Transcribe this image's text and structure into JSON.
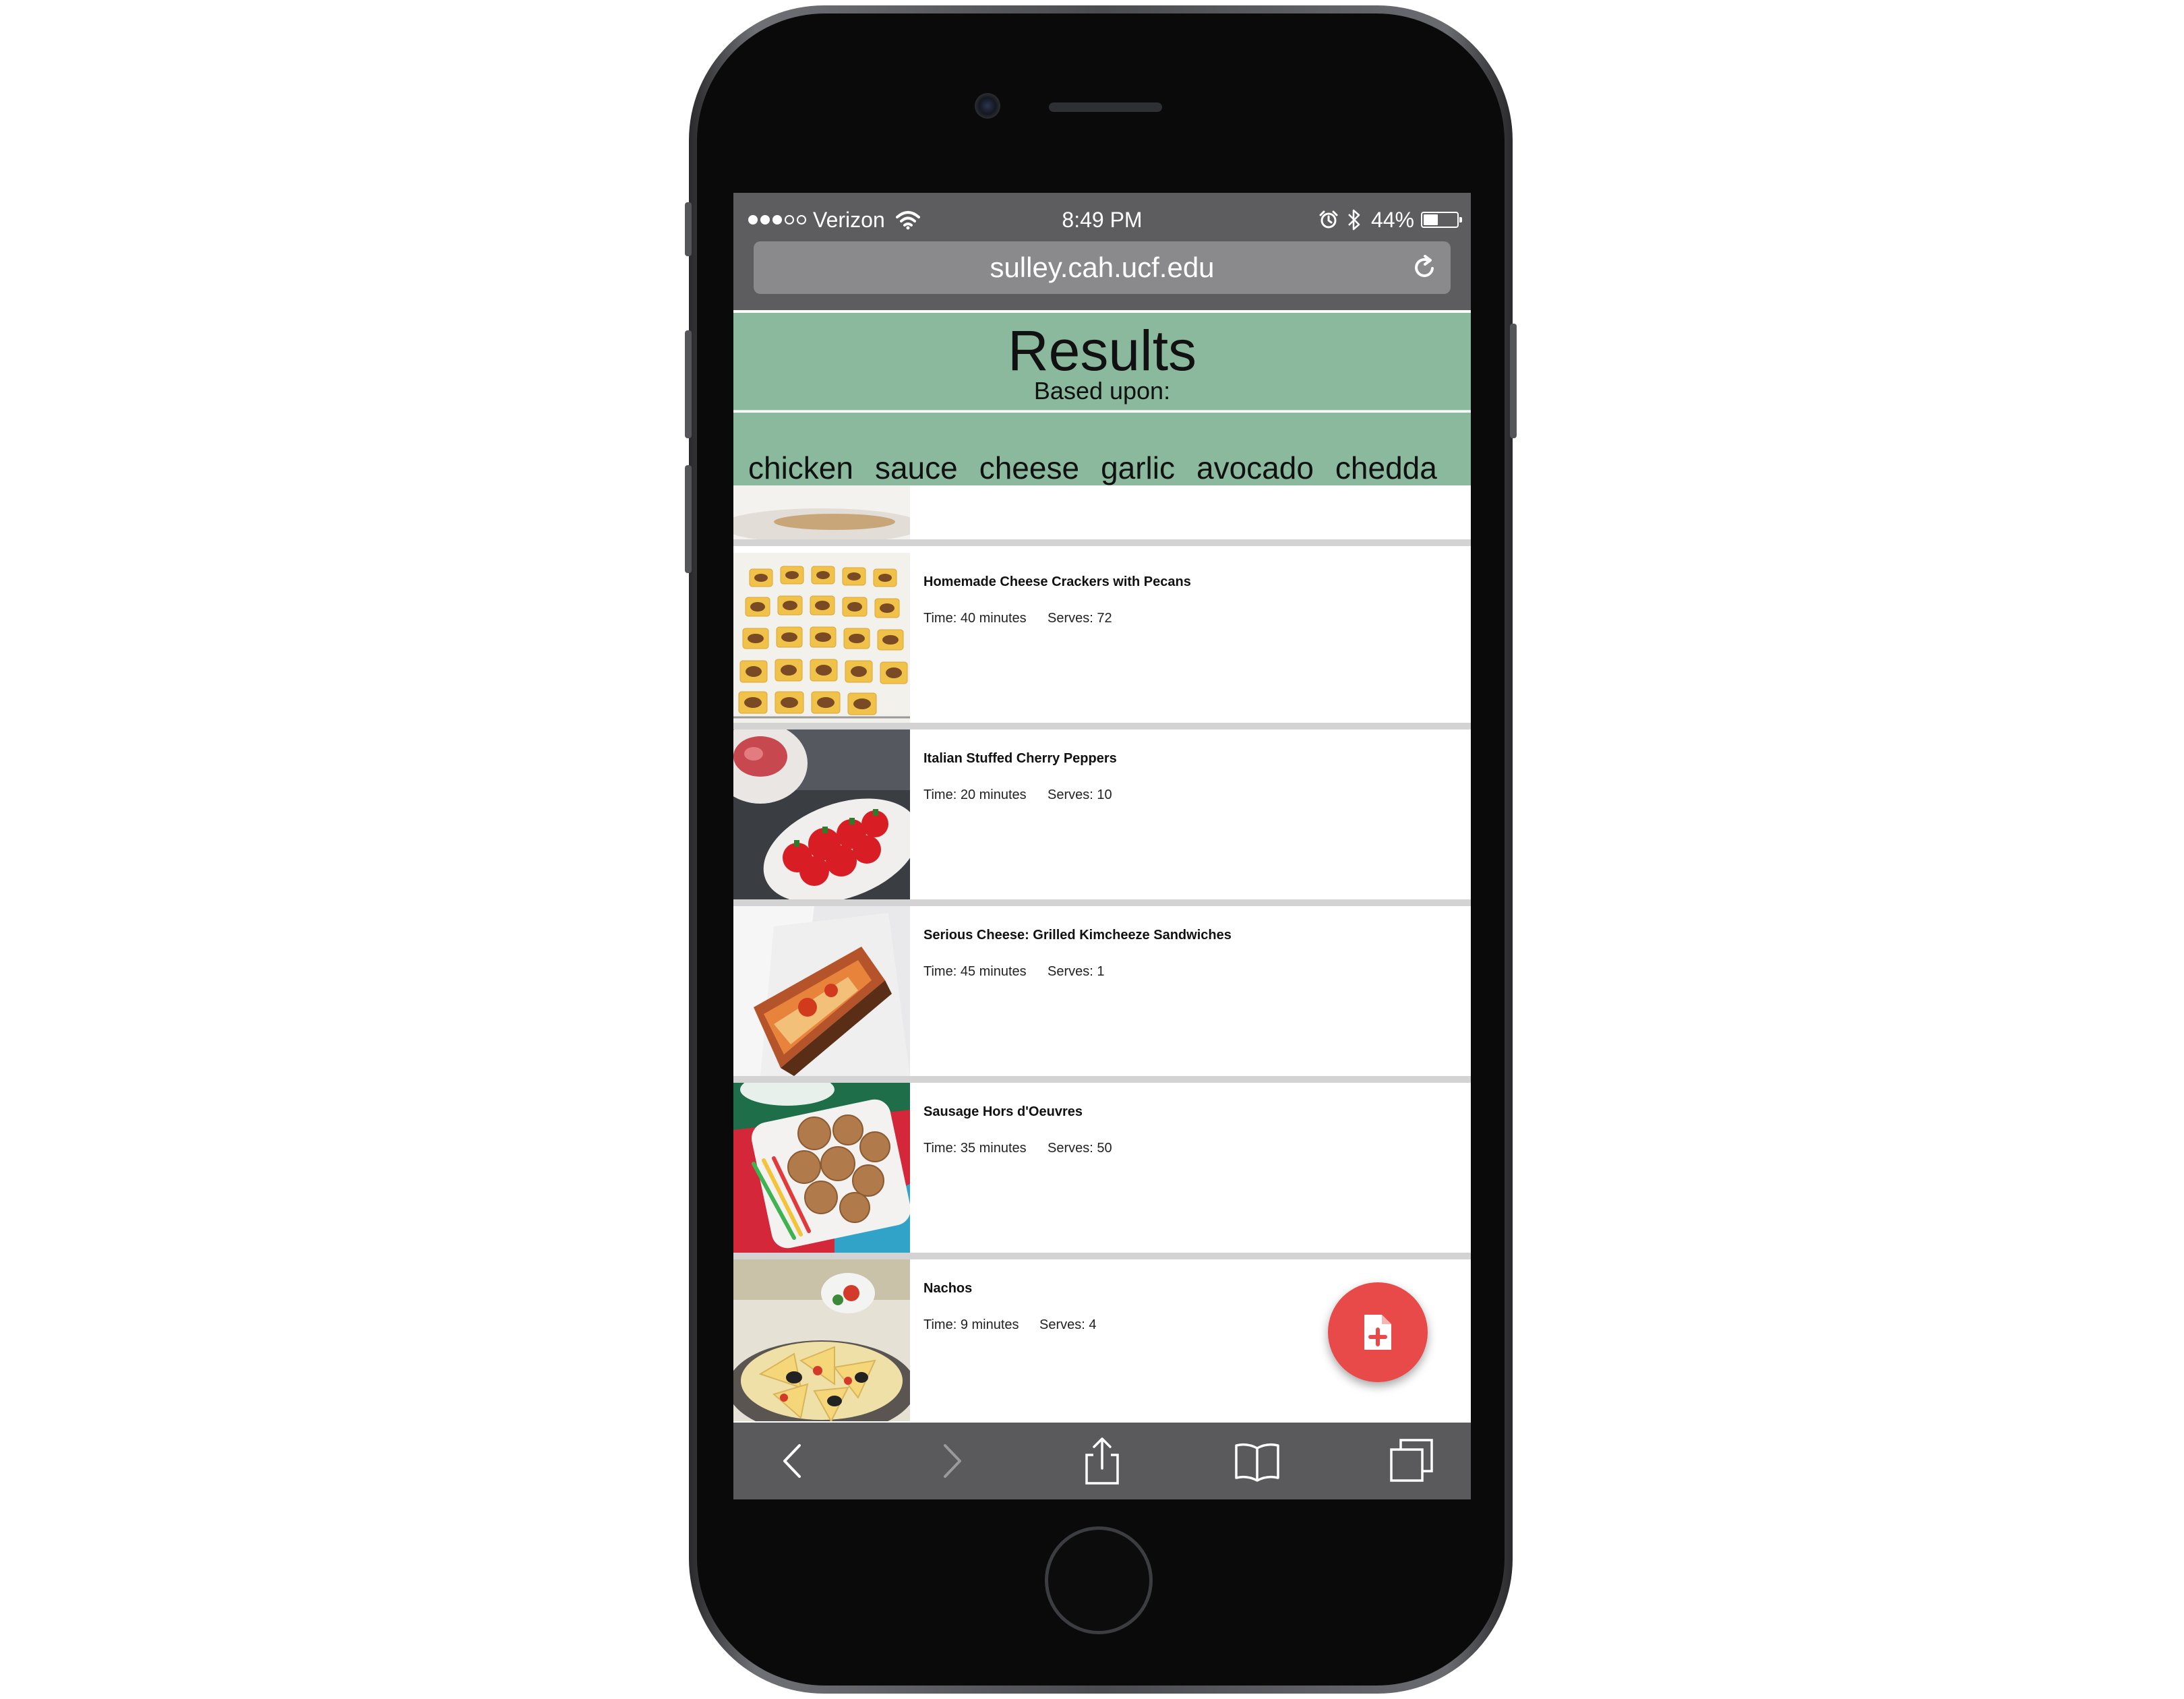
{
  "status_bar": {
    "carrier": "Verizon",
    "time": "8:49 PM",
    "battery": "44%",
    "battery_level": 0.44,
    "signal_bars_filled": 3,
    "signal_bars_total": 5
  },
  "browser": {
    "url": "sulley.cah.ucf.edu"
  },
  "results": {
    "title": "Results",
    "subtitle": "Based upon:"
  },
  "ingredients": [
    "chicken",
    "sauce",
    "cheese",
    "garlic",
    "avocado",
    "chedda"
  ],
  "recipes": [
    {
      "title": "Homemade Cheese Crackers with Pecans",
      "time": "Time: 40 minutes",
      "serves": "Serves: 72"
    },
    {
      "title": "Italian Stuffed Cherry Peppers",
      "time": "Time: 20 minutes",
      "serves": "Serves: 10"
    },
    {
      "title": "Serious Cheese: Grilled Kimcheeze Sandwiches",
      "time": "Time: 45 minutes",
      "serves": "Serves: 1"
    },
    {
      "title": "Sausage Hors d'Oeuvres",
      "time": "Time: 35 minutes",
      "serves": "Serves: 50"
    },
    {
      "title": "Nachos",
      "time": "Time: 9 minutes",
      "serves": "Serves: 4"
    }
  ],
  "colors": {
    "header_green": "#8ab99d",
    "fab_red": "#e84a4a",
    "chrome_gray": "#5d5d5f"
  },
  "icons": {
    "fab": "add-document-icon",
    "toolbar": [
      "back-icon",
      "forward-icon",
      "share-icon",
      "bookmarks-icon",
      "tabs-icon"
    ]
  }
}
